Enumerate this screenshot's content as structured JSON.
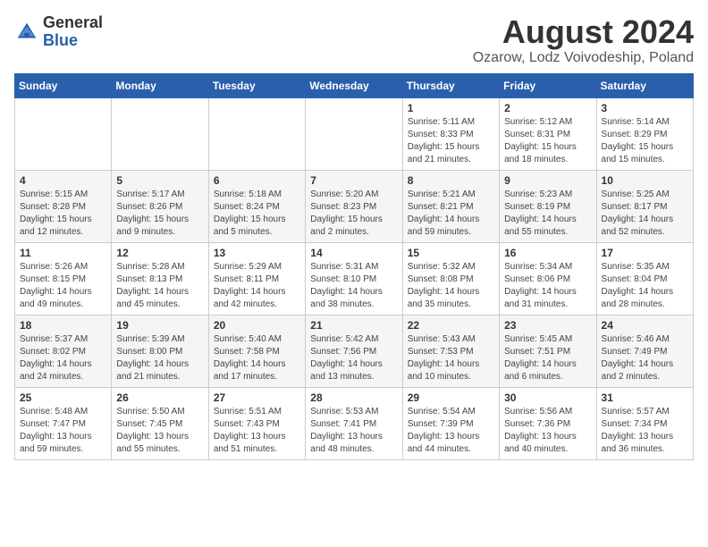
{
  "header": {
    "logo_general": "General",
    "logo_blue": "Blue",
    "month_year": "August 2024",
    "location": "Ozarow, Lodz Voivodeship, Poland"
  },
  "days_of_week": [
    "Sunday",
    "Monday",
    "Tuesday",
    "Wednesday",
    "Thursday",
    "Friday",
    "Saturday"
  ],
  "weeks": [
    [
      {
        "day": "",
        "info": ""
      },
      {
        "day": "",
        "info": ""
      },
      {
        "day": "",
        "info": ""
      },
      {
        "day": "",
        "info": ""
      },
      {
        "day": "1",
        "info": "Sunrise: 5:11 AM\nSunset: 8:33 PM\nDaylight: 15 hours and 21 minutes."
      },
      {
        "day": "2",
        "info": "Sunrise: 5:12 AM\nSunset: 8:31 PM\nDaylight: 15 hours and 18 minutes."
      },
      {
        "day": "3",
        "info": "Sunrise: 5:14 AM\nSunset: 8:29 PM\nDaylight: 15 hours and 15 minutes."
      }
    ],
    [
      {
        "day": "4",
        "info": "Sunrise: 5:15 AM\nSunset: 8:28 PM\nDaylight: 15 hours and 12 minutes."
      },
      {
        "day": "5",
        "info": "Sunrise: 5:17 AM\nSunset: 8:26 PM\nDaylight: 15 hours and 9 minutes."
      },
      {
        "day": "6",
        "info": "Sunrise: 5:18 AM\nSunset: 8:24 PM\nDaylight: 15 hours and 5 minutes."
      },
      {
        "day": "7",
        "info": "Sunrise: 5:20 AM\nSunset: 8:23 PM\nDaylight: 15 hours and 2 minutes."
      },
      {
        "day": "8",
        "info": "Sunrise: 5:21 AM\nSunset: 8:21 PM\nDaylight: 14 hours and 59 minutes."
      },
      {
        "day": "9",
        "info": "Sunrise: 5:23 AM\nSunset: 8:19 PM\nDaylight: 14 hours and 55 minutes."
      },
      {
        "day": "10",
        "info": "Sunrise: 5:25 AM\nSunset: 8:17 PM\nDaylight: 14 hours and 52 minutes."
      }
    ],
    [
      {
        "day": "11",
        "info": "Sunrise: 5:26 AM\nSunset: 8:15 PM\nDaylight: 14 hours and 49 minutes."
      },
      {
        "day": "12",
        "info": "Sunrise: 5:28 AM\nSunset: 8:13 PM\nDaylight: 14 hours and 45 minutes."
      },
      {
        "day": "13",
        "info": "Sunrise: 5:29 AM\nSunset: 8:11 PM\nDaylight: 14 hours and 42 minutes."
      },
      {
        "day": "14",
        "info": "Sunrise: 5:31 AM\nSunset: 8:10 PM\nDaylight: 14 hours and 38 minutes."
      },
      {
        "day": "15",
        "info": "Sunrise: 5:32 AM\nSunset: 8:08 PM\nDaylight: 14 hours and 35 minutes."
      },
      {
        "day": "16",
        "info": "Sunrise: 5:34 AM\nSunset: 8:06 PM\nDaylight: 14 hours and 31 minutes."
      },
      {
        "day": "17",
        "info": "Sunrise: 5:35 AM\nSunset: 8:04 PM\nDaylight: 14 hours and 28 minutes."
      }
    ],
    [
      {
        "day": "18",
        "info": "Sunrise: 5:37 AM\nSunset: 8:02 PM\nDaylight: 14 hours and 24 minutes."
      },
      {
        "day": "19",
        "info": "Sunrise: 5:39 AM\nSunset: 8:00 PM\nDaylight: 14 hours and 21 minutes."
      },
      {
        "day": "20",
        "info": "Sunrise: 5:40 AM\nSunset: 7:58 PM\nDaylight: 14 hours and 17 minutes."
      },
      {
        "day": "21",
        "info": "Sunrise: 5:42 AM\nSunset: 7:56 PM\nDaylight: 14 hours and 13 minutes."
      },
      {
        "day": "22",
        "info": "Sunrise: 5:43 AM\nSunset: 7:53 PM\nDaylight: 14 hours and 10 minutes."
      },
      {
        "day": "23",
        "info": "Sunrise: 5:45 AM\nSunset: 7:51 PM\nDaylight: 14 hours and 6 minutes."
      },
      {
        "day": "24",
        "info": "Sunrise: 5:46 AM\nSunset: 7:49 PM\nDaylight: 14 hours and 2 minutes."
      }
    ],
    [
      {
        "day": "25",
        "info": "Sunrise: 5:48 AM\nSunset: 7:47 PM\nDaylight: 13 hours and 59 minutes."
      },
      {
        "day": "26",
        "info": "Sunrise: 5:50 AM\nSunset: 7:45 PM\nDaylight: 13 hours and 55 minutes."
      },
      {
        "day": "27",
        "info": "Sunrise: 5:51 AM\nSunset: 7:43 PM\nDaylight: 13 hours and 51 minutes."
      },
      {
        "day": "28",
        "info": "Sunrise: 5:53 AM\nSunset: 7:41 PM\nDaylight: 13 hours and 48 minutes."
      },
      {
        "day": "29",
        "info": "Sunrise: 5:54 AM\nSunset: 7:39 PM\nDaylight: 13 hours and 44 minutes."
      },
      {
        "day": "30",
        "info": "Sunrise: 5:56 AM\nSunset: 7:36 PM\nDaylight: 13 hours and 40 minutes."
      },
      {
        "day": "31",
        "info": "Sunrise: 5:57 AM\nSunset: 7:34 PM\nDaylight: 13 hours and 36 minutes."
      }
    ]
  ]
}
